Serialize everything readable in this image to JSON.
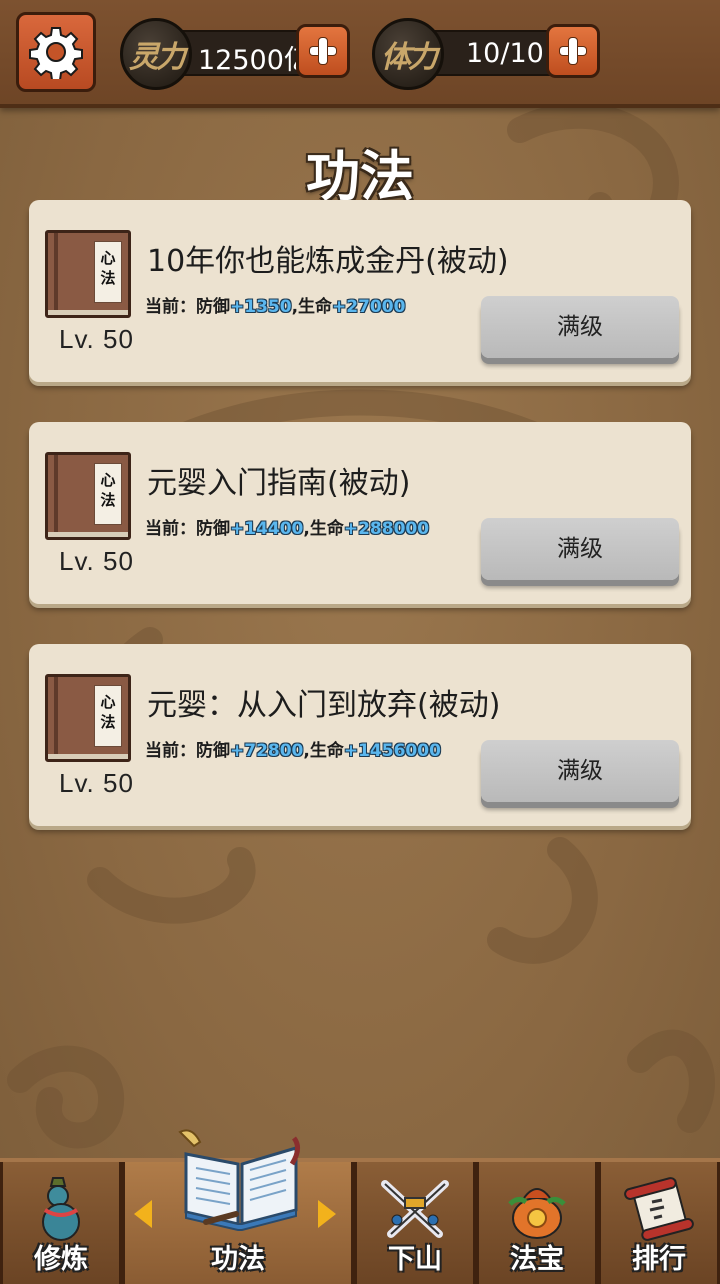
{
  "resources": {
    "spirit": {
      "badge": "灵力",
      "value": "12500亿"
    },
    "stamina": {
      "badge": "体力",
      "value": "10/10"
    }
  },
  "page_title": "功法",
  "skills": [
    {
      "book_label": "心法",
      "level": "Lv. 50",
      "name": "10年你也能炼成金丹(被动)",
      "stats_prefix": "当前：防御",
      "defense": "+1350",
      "life_label": ",生命",
      "life": "+27000",
      "button": "满级"
    },
    {
      "book_label": "心法",
      "level": "Lv. 50",
      "name": "元婴入门指南(被动)",
      "stats_prefix": "当前：防御",
      "defense": "+14400",
      "life_label": ",生命",
      "life": "+288000",
      "button": "满级"
    },
    {
      "book_label": "心法",
      "level": "Lv. 50",
      "name": "元婴：从入门到放弃(被动)",
      "stats_prefix": "当前：防御",
      "defense": "+72800",
      "life_label": ",生命",
      "life": "+1456000",
      "button": "满级"
    }
  ],
  "nav": [
    {
      "label": "修炼",
      "icon": "gourd-icon"
    },
    {
      "label": "功法",
      "icon": "open-book-icon",
      "active": true
    },
    {
      "label": "下山",
      "icon": "crossed-swords-icon"
    },
    {
      "label": "法宝",
      "icon": "treasure-bag-icon"
    },
    {
      "label": "排行",
      "icon": "scroll-icon"
    }
  ],
  "colors": {
    "accent_orange": "#d9683c",
    "stat_blue": "#5bb7ee",
    "card_bg": "#ece2d0",
    "bg_brown": "#8c6a45"
  }
}
